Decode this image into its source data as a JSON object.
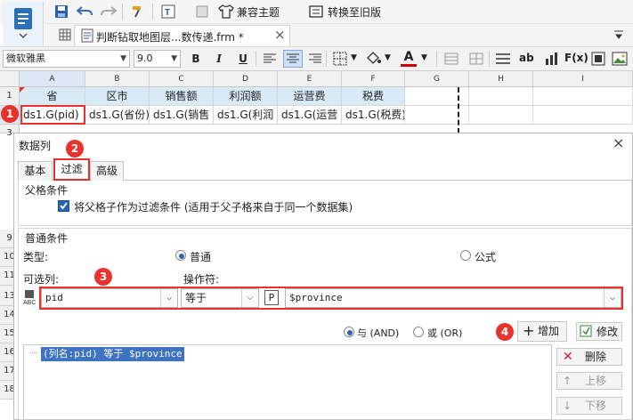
{
  "toolbar": {
    "compat_theme_label": "兼容主题",
    "convert_old_label": "转换至旧版"
  },
  "tab": {
    "file_name": "判断钻取地图层...数传递.frm *",
    "close_symbol": "×"
  },
  "format_bar": {
    "font_name": "微软雅黑",
    "font_size": "9.0",
    "bold": "B",
    "italic": "I",
    "underline": "U",
    "text_color_letter": "A",
    "abc_label": "ab",
    "formula_label": "F(x)"
  },
  "grid": {
    "columns": [
      "A",
      "B",
      "C",
      "D",
      "E",
      "F",
      "G",
      "H",
      "I"
    ],
    "rows": [
      "1",
      "2",
      "3",
      "9",
      "10",
      "11",
      "12",
      "13",
      "14",
      "15",
      "16",
      "17",
      "18"
    ],
    "header_cells": [
      "省",
      "区市",
      "销售额",
      "利润额",
      "运营费",
      "税费"
    ],
    "data_cells": [
      "ds1.G(pid)",
      "ds1.G(省份)",
      "ds1.G(销售",
      "ds1.G(利润",
      "ds1.G(运营",
      "ds1.G(税费)"
    ]
  },
  "badges": [
    "1",
    "2",
    "3",
    "4"
  ],
  "dialog": {
    "title": "数据列",
    "close_symbol": "×",
    "tabs": [
      "基本",
      "过滤",
      "高级"
    ],
    "parent_condition_title": "父格条件",
    "parent_checkbox_label": "将父格子作为过滤条件 (适用于父子格来自于同一个数据集)",
    "normal_condition_title": "普通条件",
    "type_label": "类型:",
    "type_normal": "普通",
    "type_formula": "公式",
    "optional_column_label": "可选列:",
    "operator_label": "操作符:",
    "column_value": "pid",
    "operator_value": "等于",
    "param_prefix_symbol": "P",
    "param_value": "$province",
    "and_label": "与 (AND)",
    "or_label": "或 (OR)",
    "add_label": "增加",
    "modify_label": "修改",
    "condition_item": "(列名:pid) 等于 $province",
    "delete_label": "删除",
    "up_label": "上移",
    "down_label": "下移"
  },
  "colors": {
    "accent": "#e8322b",
    "header_fill": "#d9eaf7",
    "selection_blue": "#3e73c4"
  }
}
